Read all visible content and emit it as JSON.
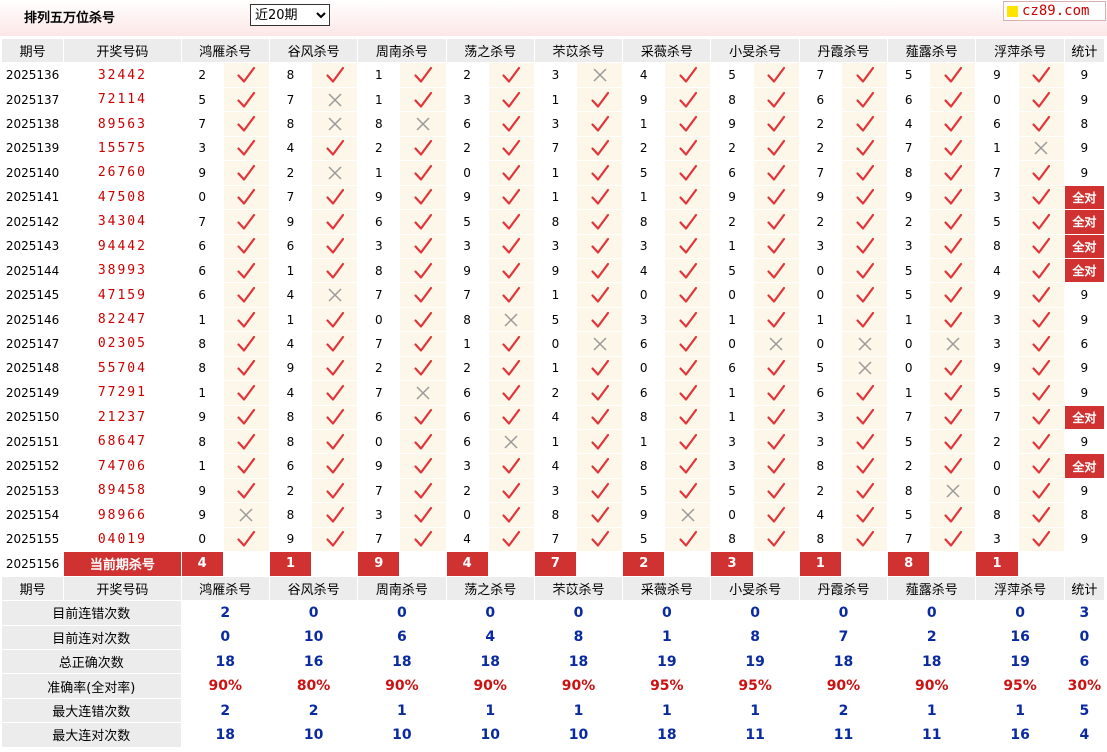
{
  "header": {
    "title": "排列五万位杀号",
    "period_selected": "近20期",
    "logo_text": "cz89.com"
  },
  "columns": {
    "issue": "期号",
    "draw": "开奖号码",
    "experts": [
      "鸿雁杀号",
      "谷风杀号",
      "周南杀号",
      "荡之杀号",
      "芣苡杀号",
      "采薇杀号",
      "小旻杀号",
      "丹霞杀号",
      "薤露杀号",
      "浮萍杀号"
    ],
    "total": "统计"
  },
  "rows": [
    {
      "issue": "2025136",
      "draw": "32442",
      "kills": [
        2,
        8,
        1,
        2,
        3,
        4,
        5,
        7,
        5,
        9
      ],
      "hits": [
        1,
        1,
        1,
        1,
        0,
        1,
        1,
        1,
        1,
        1
      ],
      "total": "9"
    },
    {
      "issue": "2025137",
      "draw": "72114",
      "kills": [
        5,
        7,
        1,
        3,
        1,
        9,
        8,
        6,
        6,
        0
      ],
      "hits": [
        1,
        0,
        1,
        1,
        1,
        1,
        1,
        1,
        1,
        1
      ],
      "total": "9"
    },
    {
      "issue": "2025138",
      "draw": "89563",
      "kills": [
        7,
        8,
        8,
        6,
        3,
        1,
        9,
        2,
        4,
        6
      ],
      "hits": [
        1,
        0,
        0,
        1,
        1,
        1,
        1,
        1,
        1,
        1
      ],
      "total": "8"
    },
    {
      "issue": "2025139",
      "draw": "15575",
      "kills": [
        3,
        4,
        2,
        2,
        7,
        2,
        2,
        2,
        7,
        1
      ],
      "hits": [
        1,
        1,
        1,
        1,
        1,
        1,
        1,
        1,
        1,
        0
      ],
      "total": "9"
    },
    {
      "issue": "2025140",
      "draw": "26760",
      "kills": [
        9,
        2,
        1,
        0,
        1,
        5,
        6,
        7,
        8,
        7
      ],
      "hits": [
        1,
        0,
        1,
        1,
        1,
        1,
        1,
        1,
        1,
        1
      ],
      "total": "9"
    },
    {
      "issue": "2025141",
      "draw": "47508",
      "kills": [
        0,
        7,
        9,
        9,
        1,
        1,
        9,
        9,
        9,
        3
      ],
      "hits": [
        1,
        1,
        1,
        1,
        1,
        1,
        1,
        1,
        1,
        1
      ],
      "total": "全对"
    },
    {
      "issue": "2025142",
      "draw": "34304",
      "kills": [
        7,
        9,
        6,
        5,
        8,
        8,
        2,
        2,
        2,
        5
      ],
      "hits": [
        1,
        1,
        1,
        1,
        1,
        1,
        1,
        1,
        1,
        1
      ],
      "total": "全对"
    },
    {
      "issue": "2025143",
      "draw": "94442",
      "kills": [
        6,
        6,
        3,
        3,
        3,
        3,
        1,
        3,
        3,
        8
      ],
      "hits": [
        1,
        1,
        1,
        1,
        1,
        1,
        1,
        1,
        1,
        1
      ],
      "total": "全对"
    },
    {
      "issue": "2025144",
      "draw": "38993",
      "kills": [
        6,
        1,
        8,
        9,
        9,
        4,
        5,
        0,
        5,
        4
      ],
      "hits": [
        1,
        1,
        1,
        1,
        1,
        1,
        1,
        1,
        1,
        1
      ],
      "total": "全对"
    },
    {
      "issue": "2025145",
      "draw": "47159",
      "kills": [
        6,
        4,
        7,
        7,
        1,
        0,
        0,
        0,
        5,
        9
      ],
      "hits": [
        1,
        0,
        1,
        1,
        1,
        1,
        1,
        1,
        1,
        1
      ],
      "total": "9"
    },
    {
      "issue": "2025146",
      "draw": "82247",
      "kills": [
        1,
        1,
        0,
        8,
        5,
        3,
        1,
        1,
        1,
        3
      ],
      "hits": [
        1,
        1,
        1,
        0,
        1,
        1,
        1,
        1,
        1,
        1
      ],
      "total": "9"
    },
    {
      "issue": "2025147",
      "draw": "02305",
      "kills": [
        8,
        4,
        7,
        1,
        0,
        6,
        0,
        0,
        0,
        3
      ],
      "hits": [
        1,
        1,
        1,
        1,
        0,
        1,
        0,
        0,
        0,
        1
      ],
      "total": "6"
    },
    {
      "issue": "2025148",
      "draw": "55704",
      "kills": [
        8,
        9,
        2,
        2,
        1,
        0,
        6,
        5,
        0,
        9
      ],
      "hits": [
        1,
        1,
        1,
        1,
        1,
        1,
        1,
        0,
        1,
        1
      ],
      "total": "9"
    },
    {
      "issue": "2025149",
      "draw": "77291",
      "kills": [
        1,
        4,
        7,
        6,
        2,
        6,
        1,
        6,
        1,
        5
      ],
      "hits": [
        1,
        1,
        0,
        1,
        1,
        1,
        1,
        1,
        1,
        1
      ],
      "total": "9"
    },
    {
      "issue": "2025150",
      "draw": "21237",
      "kills": [
        9,
        8,
        6,
        6,
        4,
        8,
        1,
        3,
        7,
        7
      ],
      "hits": [
        1,
        1,
        1,
        1,
        1,
        1,
        1,
        1,
        1,
        1
      ],
      "total": "全对"
    },
    {
      "issue": "2025151",
      "draw": "68647",
      "kills": [
        8,
        8,
        0,
        6,
        1,
        1,
        3,
        3,
        5,
        2
      ],
      "hits": [
        1,
        1,
        1,
        0,
        1,
        1,
        1,
        1,
        1,
        1
      ],
      "total": "9"
    },
    {
      "issue": "2025152",
      "draw": "74706",
      "kills": [
        1,
        6,
        9,
        3,
        4,
        8,
        3,
        8,
        2,
        0
      ],
      "hits": [
        1,
        1,
        1,
        1,
        1,
        1,
        1,
        1,
        1,
        1
      ],
      "total": "全对"
    },
    {
      "issue": "2025153",
      "draw": "89458",
      "kills": [
        9,
        2,
        7,
        2,
        3,
        5,
        5,
        2,
        8,
        0
      ],
      "hits": [
        1,
        1,
        1,
        1,
        1,
        1,
        1,
        1,
        0,
        1
      ],
      "total": "9"
    },
    {
      "issue": "2025154",
      "draw": "98966",
      "kills": [
        9,
        8,
        3,
        0,
        8,
        9,
        0,
        4,
        5,
        8
      ],
      "hits": [
        0,
        1,
        1,
        1,
        1,
        0,
        1,
        1,
        1,
        1
      ],
      "total": "8"
    },
    {
      "issue": "2025155",
      "draw": "04019",
      "kills": [
        0,
        9,
        7,
        4,
        7,
        5,
        8,
        8,
        7,
        3
      ],
      "hits": [
        1,
        1,
        1,
        1,
        1,
        1,
        1,
        1,
        1,
        1
      ],
      "total": "9"
    }
  ],
  "current": {
    "issue": "2025156",
    "label": "当前期杀号",
    "kills": [
      "4",
      "1",
      "9",
      "4",
      "7",
      "2",
      "3",
      "1",
      "8",
      "1"
    ]
  },
  "stats": [
    {
      "label": "目前连错次数",
      "values": [
        "2",
        "0",
        "0",
        "0",
        "0",
        "0",
        "0",
        "0",
        "0",
        "0"
      ],
      "total": "3",
      "style": "blue"
    },
    {
      "label": "目前连对次数",
      "values": [
        "0",
        "10",
        "6",
        "4",
        "8",
        "1",
        "8",
        "7",
        "2",
        "16"
      ],
      "total": "0",
      "style": "blue"
    },
    {
      "label": "总正确次数",
      "values": [
        "18",
        "16",
        "18",
        "18",
        "18",
        "19",
        "19",
        "18",
        "18",
        "19"
      ],
      "total": "6",
      "style": "blue"
    },
    {
      "label": "准确率(全对率)",
      "values": [
        "90%",
        "80%",
        "90%",
        "90%",
        "90%",
        "95%",
        "95%",
        "90%",
        "90%",
        "95%"
      ],
      "total": "30%",
      "style": "red"
    },
    {
      "label": "最大连错次数",
      "values": [
        "2",
        "2",
        "1",
        "1",
        "1",
        "1",
        "1",
        "2",
        "1",
        "1"
      ],
      "total": "5",
      "style": "blue"
    },
    {
      "label": "最大连对次数",
      "values": [
        "18",
        "10",
        "10",
        "10",
        "10",
        "18",
        "11",
        "11",
        "11",
        "16"
      ],
      "total": "4",
      "style": "blue"
    }
  ],
  "icons": {
    "hit": "check-icon",
    "miss": "cross-icon"
  },
  "colors": {
    "hit": "#e0353a",
    "miss": "#9a9a9a",
    "full_bg": "#d03232",
    "mark_bg": "#fdf7e9",
    "header_bg": "#ececec",
    "stat_blue": "#0a2aa0",
    "stat_red": "#cc1111"
  }
}
